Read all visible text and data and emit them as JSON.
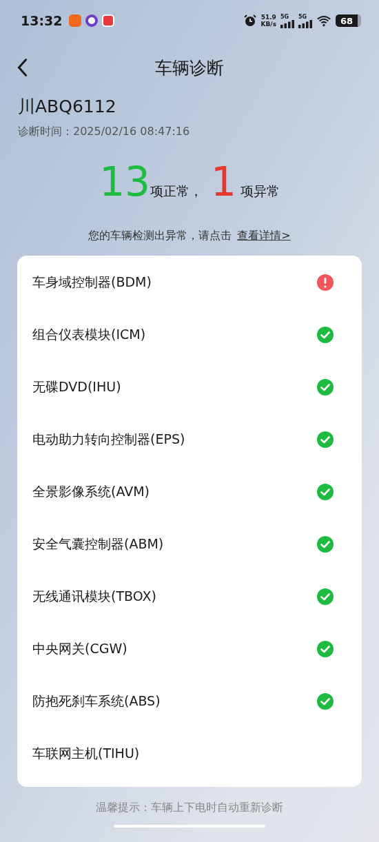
{
  "status_bar": {
    "time": "13:32",
    "net_speed": "51.9",
    "net_unit": "KB/s",
    "sim_1": "5G",
    "sim_2": "5G",
    "battery": "68"
  },
  "header": {
    "title": "车辆诊断"
  },
  "vehicle": {
    "plate": "川ABQ6112",
    "time_label": "诊断时间：",
    "time": "2025/02/16 08:47:16"
  },
  "summary": {
    "normal_count": "13",
    "normal_label": "项正常，",
    "abnormal_count": "1",
    "abnormal_label": "项异常"
  },
  "notice": {
    "text": "您的车辆检测出异常，请点击",
    "link": "查看详情>"
  },
  "items": [
    {
      "name": "车身域控制器(BDM)",
      "kind": "error"
    },
    {
      "name": "组合仪表模块(ICM)",
      "kind": "ok"
    },
    {
      "name": "无碟DVD(IHU)",
      "kind": "ok"
    },
    {
      "name": "电动助力转向控制器(EPS)",
      "kind": "ok"
    },
    {
      "name": "全景影像系统(AVM)",
      "kind": "ok"
    },
    {
      "name": "安全气囊控制器(ABM)",
      "kind": "ok"
    },
    {
      "name": "无线通讯模块(TBOX)",
      "kind": "ok"
    },
    {
      "name": "中央网关(CGW)",
      "kind": "ok"
    },
    {
      "name": "防抱死刹车系统(ABS)",
      "kind": "ok"
    },
    {
      "name": "车联网主机(TIHU)",
      "kind": "pending"
    }
  ],
  "footer_tip": "温馨提示：车辆上下电时自动重新诊断"
}
